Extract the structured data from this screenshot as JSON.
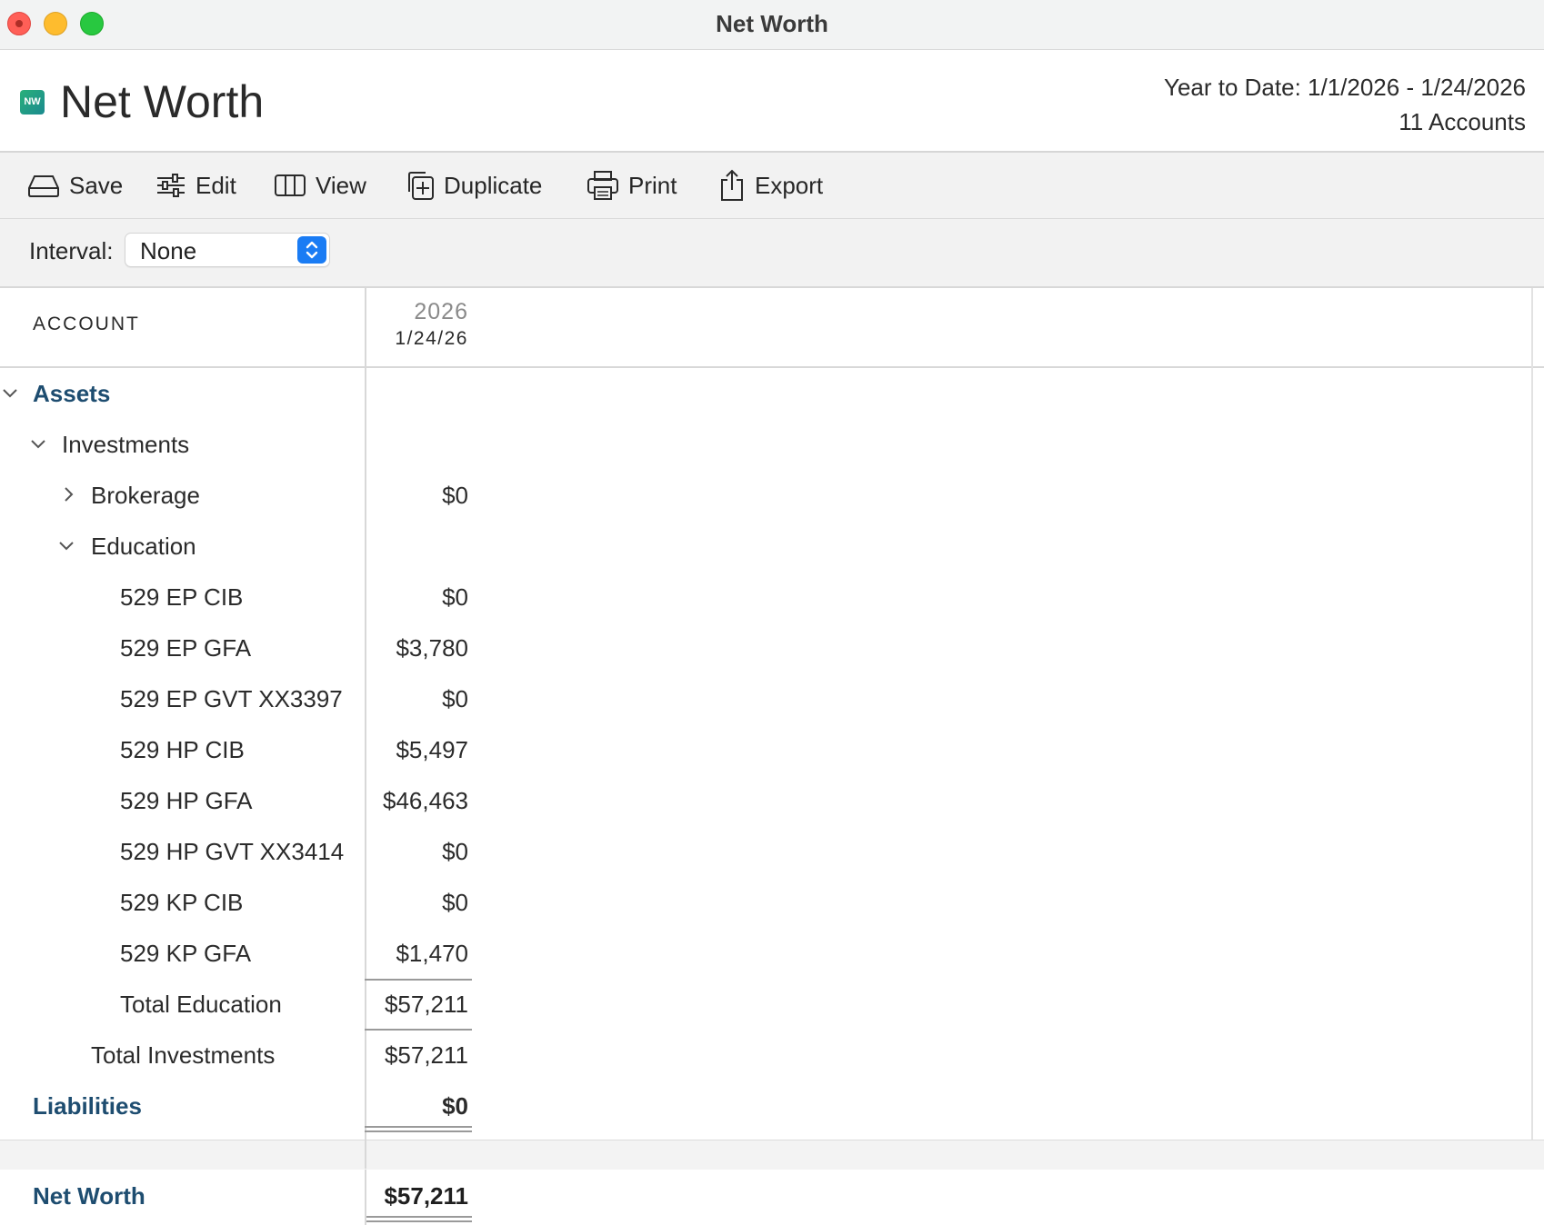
{
  "window": {
    "title": "Net Worth"
  },
  "header": {
    "app_icon_text": "NW",
    "title": "Net Worth",
    "date_range": "Year to Date: 1/1/2026 - 1/24/2026",
    "account_count": "11 Accounts"
  },
  "toolbar": {
    "save": "Save",
    "edit": "Edit",
    "view": "View",
    "duplicate": "Duplicate",
    "print": "Print",
    "export": "Export"
  },
  "interval": {
    "label": "Interval:",
    "value": "None"
  },
  "table": {
    "account_header": "ACCOUNT",
    "year_header": "2026",
    "date_header": "1/24/26",
    "rows": [
      {
        "label": "Assets",
        "value": ""
      },
      {
        "label": "Investments",
        "value": ""
      },
      {
        "label": "Brokerage",
        "value": "$0"
      },
      {
        "label": "Education",
        "value": ""
      },
      {
        "label": "529 EP CIB",
        "value": "$0"
      },
      {
        "label": "529 EP GFA",
        "value": "$3,780"
      },
      {
        "label": "529 EP GVT XX3397",
        "value": "$0"
      },
      {
        "label": "529 HP CIB",
        "value": "$5,497"
      },
      {
        "label": "529 HP GFA",
        "value": "$46,463"
      },
      {
        "label": "529 HP GVT XX3414",
        "value": "$0"
      },
      {
        "label": "529 KP CIB",
        "value": "$0"
      },
      {
        "label": "529 KP GFA",
        "value": "$1,470"
      },
      {
        "label": "Total Education",
        "value": "$57,211"
      },
      {
        "label": "Total Investments",
        "value": "$57,211"
      },
      {
        "label": "Liabilities",
        "value": "$0"
      }
    ],
    "net_worth_label": "Net Worth",
    "net_worth_value": "$57,211"
  },
  "colors": {
    "section_text": "#1e4d70",
    "accent": "#1a7cf4"
  }
}
